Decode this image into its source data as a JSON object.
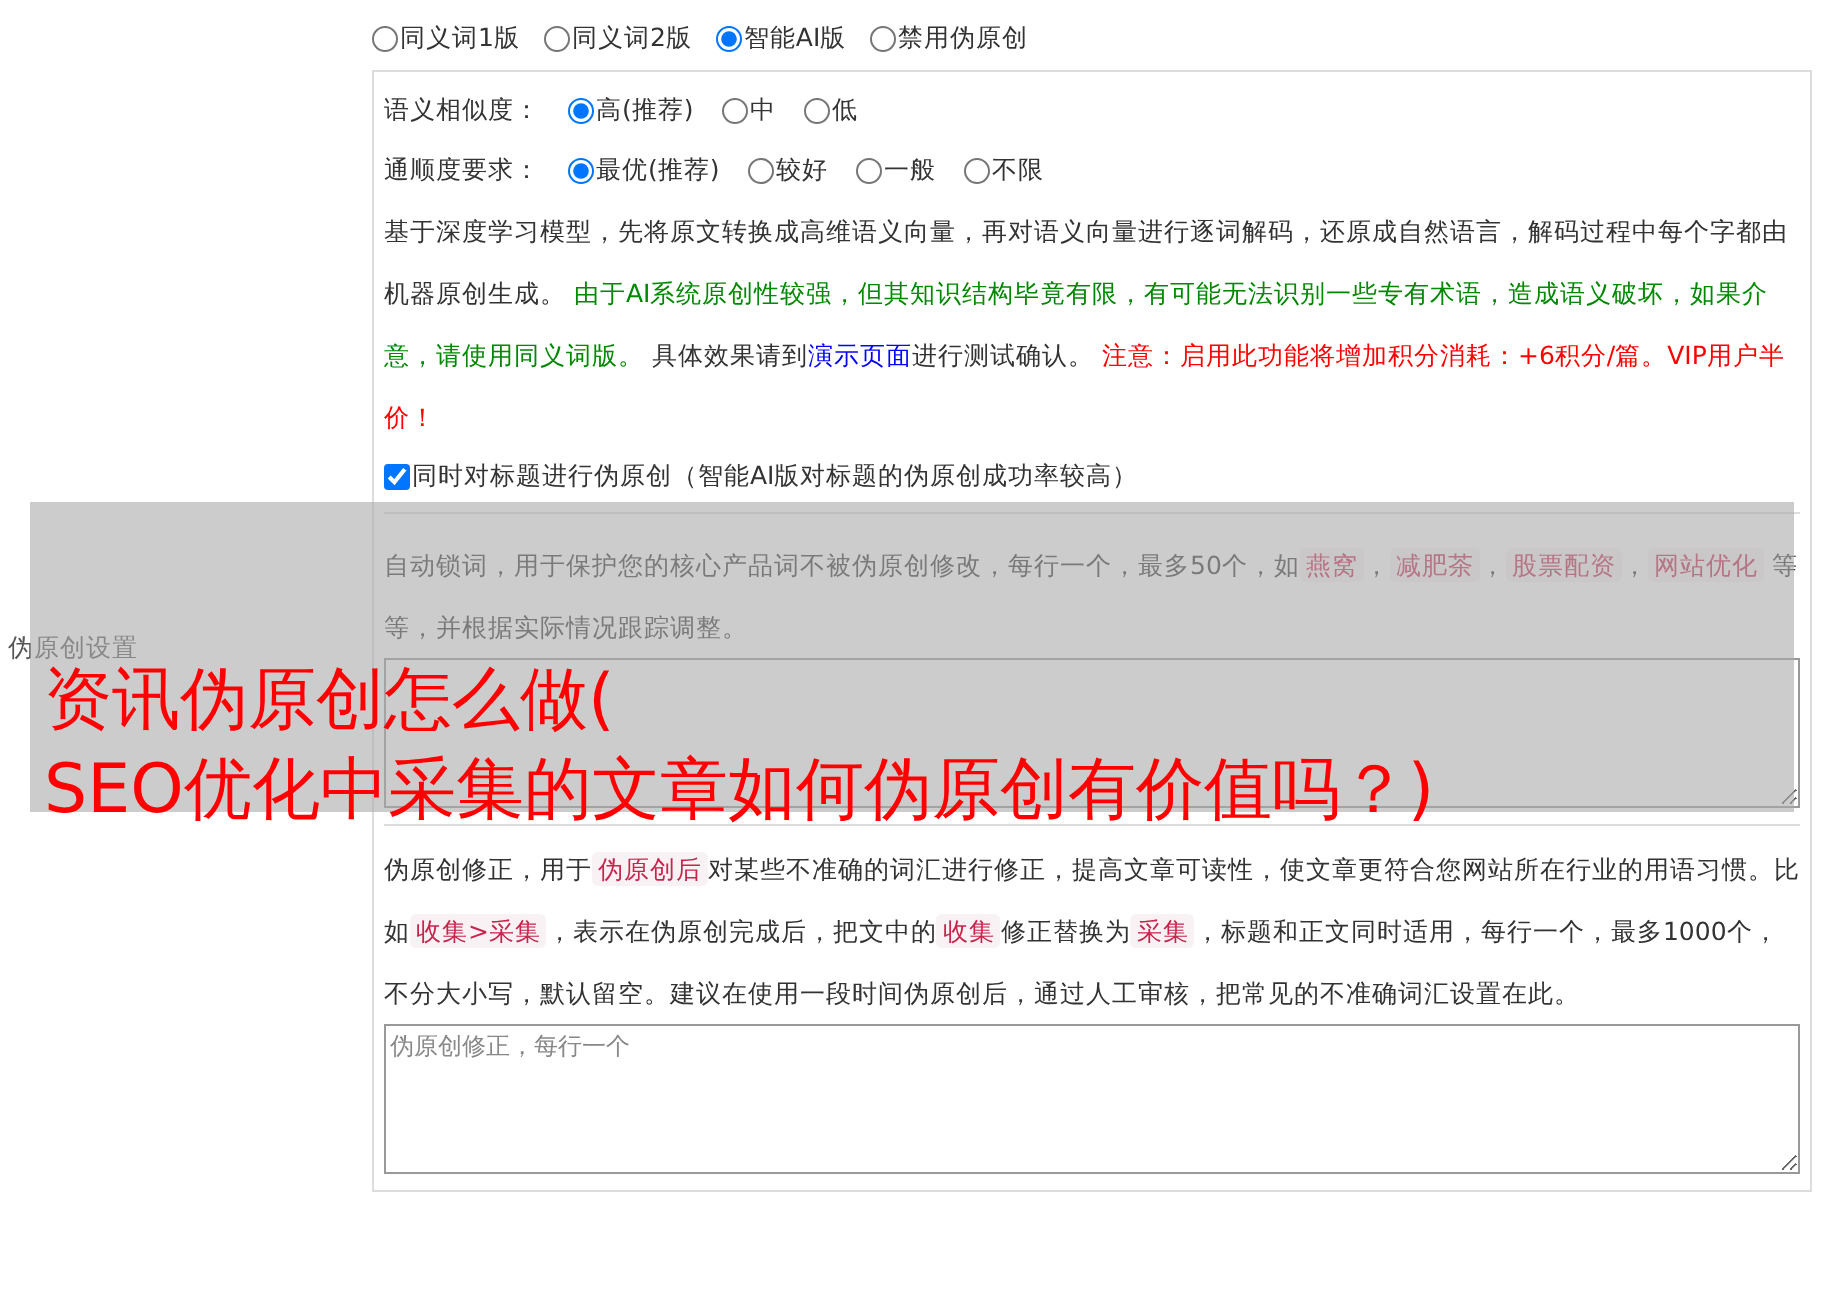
{
  "side_label": "伪原创设置",
  "modes": [
    {
      "label": "同义词1版",
      "selected": false
    },
    {
      "label": "同义词2版",
      "selected": false
    },
    {
      "label": "智能AI版",
      "selected": true
    },
    {
      "label": "禁用伪原创",
      "selected": false
    }
  ],
  "similarity": {
    "label": "语义相似度：",
    "options": [
      {
        "label": "高(推荐)",
        "selected": true
      },
      {
        "label": "中",
        "selected": false
      },
      {
        "label": "低",
        "selected": false
      }
    ]
  },
  "fluency": {
    "label": "通顺度要求：",
    "options": [
      {
        "label": "最优(推荐)",
        "selected": true
      },
      {
        "label": "较好",
        "selected": false
      },
      {
        "label": "一般",
        "selected": false
      },
      {
        "label": "不限",
        "selected": false
      }
    ]
  },
  "ai_description": [
    {
      "kind": "plain",
      "text": "基于深度学习模型，先将原文转换成高维语义向量，再对语义向量进行逐词解码，还原成自然语言，解码过程中每个字都由机器原创生成。 "
    },
    {
      "kind": "note",
      "text": "由于AI系统原创性较强，但其知识结构毕竟有限，有可能无法识别一些专有术语，造成语义破坏，如果介意，请使用同义词版。"
    },
    {
      "kind": "plain",
      "text": " 具体效果请到"
    },
    {
      "kind": "link",
      "text": "演示页面"
    },
    {
      "kind": "plain",
      "text": "进行测试确认。 "
    },
    {
      "kind": "warning",
      "text": "注意：启用此功能将增加积分消耗：+6积分/篇。VIP用户半价！"
    }
  ],
  "title_option": {
    "label": "同时对标题进行伪原创（智能AI版对标题的伪原创成功率较高）",
    "checked": true
  },
  "lock_description": [
    {
      "kind": "plain",
      "text": "自动锁词，用于保护您的核心产品词不被伪原创修改，每行一个，最多50个，如"
    },
    {
      "kind": "tag",
      "text": "燕窝"
    },
    {
      "kind": "plain",
      "text": "，"
    },
    {
      "kind": "tag",
      "text": "减肥茶"
    },
    {
      "kind": "plain",
      "text": "，"
    },
    {
      "kind": "tag",
      "text": "股票配资"
    },
    {
      "kind": "plain",
      "text": "，"
    },
    {
      "kind": "tag",
      "text": "网站优化"
    },
    {
      "kind": "plain",
      "text": " 等等，并根据实际情况跟踪调整。"
    }
  ],
  "fix_description": [
    {
      "kind": "plain",
      "text": "伪原创修正，用于"
    },
    {
      "kind": "tag",
      "text": "伪原创后"
    },
    {
      "kind": "plain",
      "text": "对某些不准确的词汇进行修正，提高文章可读性，使文章更符合您网站所在行业的用语习惯。比如"
    },
    {
      "kind": "tag",
      "text": "收集>采集"
    },
    {
      "kind": "plain",
      "text": "，表示在伪原创完成后，把文中的"
    },
    {
      "kind": "tag",
      "text": "收集"
    },
    {
      "kind": "plain",
      "text": "修正替换为"
    },
    {
      "kind": "tag",
      "text": "采集"
    },
    {
      "kind": "plain",
      "text": "，标题和正文同时适用，每行一个，最多1000个，不分大小写，默认留空。建议在使用一段时间伪原创后，通过人工审核，把常见的不准确词汇设置在此。"
    }
  ],
  "fix_field": {
    "placeholder": "伪原创修正，每行一个"
  },
  "overlay_title": [
    "资讯伪原创怎么做(",
    "SEO优化中采集的文章如何伪原创有价值吗？)"
  ]
}
